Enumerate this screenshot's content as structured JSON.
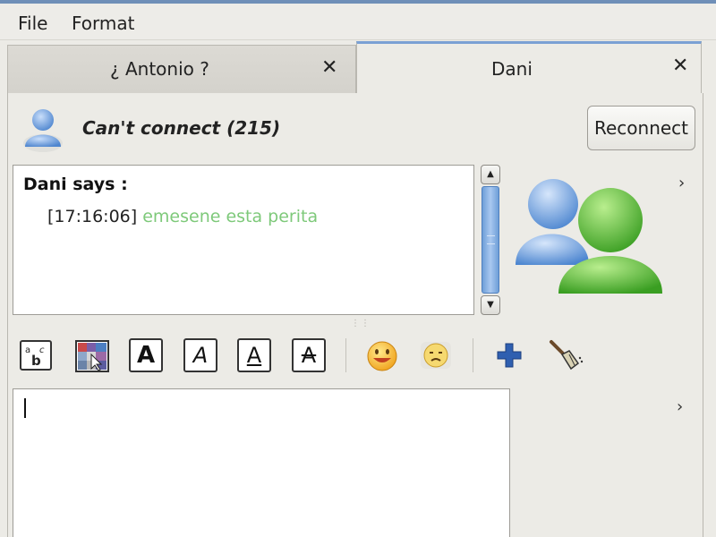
{
  "menubar": {
    "items": [
      {
        "label": "File"
      },
      {
        "label": "Format"
      }
    ]
  },
  "tabs": [
    {
      "label": "¿ Antonio ?",
      "close": "✕",
      "active": false
    },
    {
      "label": "Dani",
      "close": "✕",
      "active": true
    }
  ],
  "status": {
    "text": "Can't connect (215)",
    "reconnect_label": "Reconnect"
  },
  "conversation": {
    "sender_line": "Dani says :",
    "messages": [
      {
        "time": "[17:16:06]",
        "text": "emesene esta perita",
        "color": "#7ec97a"
      }
    ]
  },
  "toolbar": {
    "buttons": [
      {
        "icon": "spellcheck-icon"
      },
      {
        "icon": "font-color-icon"
      },
      {
        "icon": "bold-icon",
        "glyph": "A"
      },
      {
        "icon": "italic-icon",
        "glyph": "A"
      },
      {
        "icon": "underline-icon",
        "glyph": "A"
      },
      {
        "icon": "strikethrough-icon",
        "glyph": "A"
      },
      {
        "icon": "emoticon-icon"
      },
      {
        "icon": "wink-icon"
      },
      {
        "icon": "invite-icon"
      },
      {
        "icon": "clear-icon"
      }
    ]
  },
  "side": {
    "expand_glyph": "›"
  },
  "colors": {
    "accent_tab": "#7aa0d4",
    "message_text": "#7ec97a",
    "avatar_blue": "#5f95d8",
    "avatar_green": "#4fb334"
  }
}
